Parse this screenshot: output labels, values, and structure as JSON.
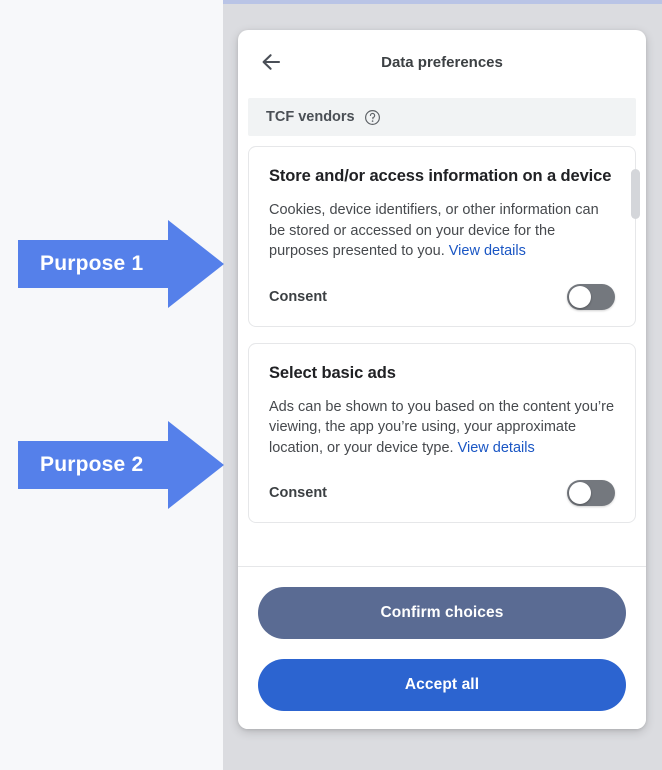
{
  "overlay": {
    "top_strip_color": "#b9c4e6",
    "backdrop_color": "#dbdce0"
  },
  "annotations": {
    "arrow_color": "#5580ea",
    "items": [
      {
        "label": "Purpose 1"
      },
      {
        "label": "Purpose 2"
      }
    ]
  },
  "dialog": {
    "back_icon": "arrow-left-icon",
    "title": "Data preferences",
    "section": {
      "title": "TCF vendors",
      "help_icon": "question-mark-circle-icon"
    },
    "cards": [
      {
        "title": "Store and/or access information on a device",
        "description": "Cookies, device identifiers, or other information can be stored or accessed on your device for the purposes presented to you. ",
        "link_text": "View details",
        "consent_label": "Consent",
        "consent_state": "off"
      },
      {
        "title": "Select basic ads",
        "description": "Ads can be shown to you based on the content you’re viewing, the app you’re using, your approximate location, or your device type. ",
        "link_text": "View details",
        "consent_label": "Consent",
        "consent_state": "off"
      }
    ],
    "footer": {
      "confirm_label": "Confirm choices",
      "accept_all_label": "Accept all",
      "confirm_color": "#5a6b93",
      "accept_all_color": "#2c64d0"
    },
    "scrollbar": {
      "thumb_color": "#d4d6da"
    }
  }
}
